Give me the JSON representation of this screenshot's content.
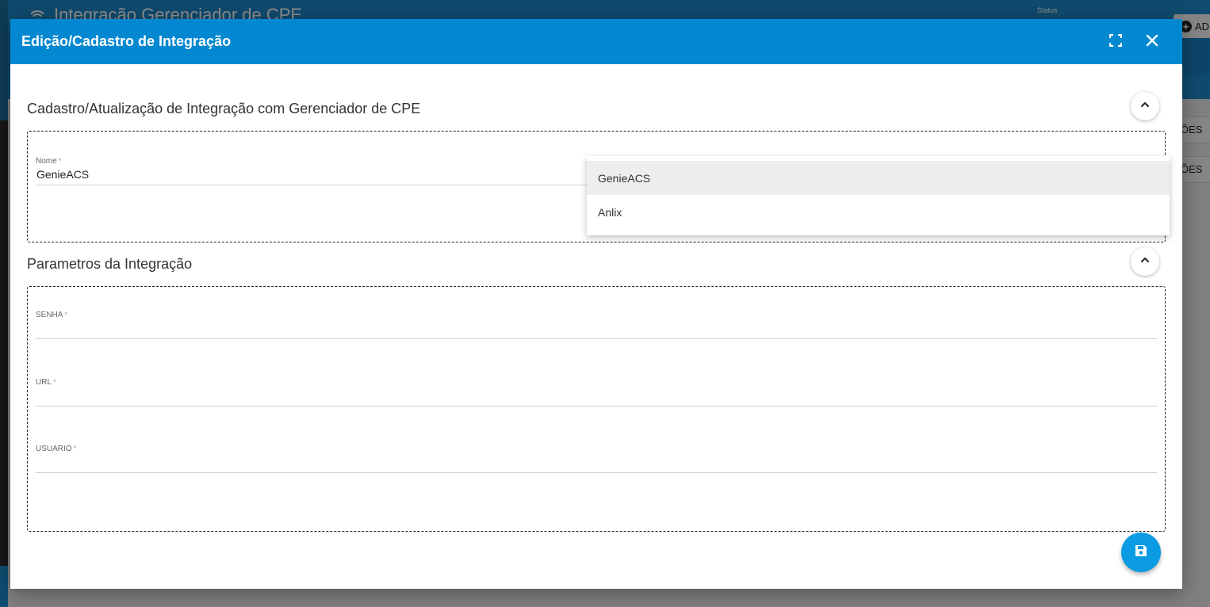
{
  "background": {
    "page_title": "Integração Gerenciador de CPE",
    "status_label": "Status",
    "add_button_label": "AD",
    "right_buttons": [
      "ÕES",
      "ÕES"
    ]
  },
  "dialog": {
    "title": "Edição/Cadastro de Integração",
    "sections": {
      "cadastro": {
        "title": "Cadastro/Atualização de Integração com Gerenciador de CPE",
        "nome": {
          "label": "Nome",
          "required_mark": "*",
          "value": "GenieACS"
        }
      },
      "parametros": {
        "title": "Parametros da Integração",
        "senha": {
          "label": "SENHA",
          "required_mark": "*",
          "value": ""
        },
        "url": {
          "label": "URL",
          "required_mark": "*",
          "value": ""
        },
        "usuario": {
          "label": "USUARIO",
          "required_mark": "*",
          "value": ""
        }
      }
    },
    "dropdown": {
      "options": [
        "GenieACS",
        "Anlix"
      ],
      "highlighted": "GenieACS"
    }
  },
  "colors": {
    "header_blue": "#0288d1",
    "fab_blue": "#0a9be3"
  },
  "icons": {
    "maximize": "maximize-icon",
    "close": "close-icon",
    "collapse": "chevron-up-icon",
    "save": "save-icon",
    "wifi": "wifi-icon",
    "add": "plus-circle-icon"
  }
}
